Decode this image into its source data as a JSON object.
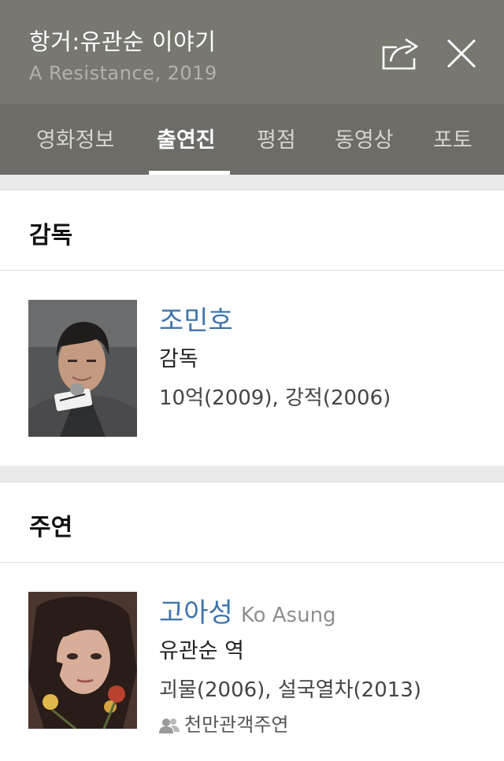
{
  "header": {
    "title": "항거:유관순 이야기",
    "subtitle": "A Resistance, 2019"
  },
  "tabs": [
    {
      "label": "영화정보"
    },
    {
      "label": "출연진"
    },
    {
      "label": "평점"
    },
    {
      "label": "동영상"
    },
    {
      "label": "포토"
    }
  ],
  "active_tab": "출연진",
  "sections": {
    "director": {
      "heading": "감독",
      "person": {
        "name": "조민호",
        "role": "감독",
        "works": "10억(2009), 강적(2006)"
      }
    },
    "lead": {
      "heading": "주연",
      "person": {
        "name": "고아성",
        "name_en": "Ko Asung",
        "role": "유관순 역",
        "works": "괴물(2006), 설국열차(2013)",
        "badge": "천만관객주연"
      }
    }
  },
  "colors": {
    "header_bg": "#787770",
    "tabs_bg": "#6d6c66",
    "link": "#3f74ad"
  },
  "icons": {
    "share": "share-icon",
    "close": "close-icon",
    "people": "people-icon"
  }
}
